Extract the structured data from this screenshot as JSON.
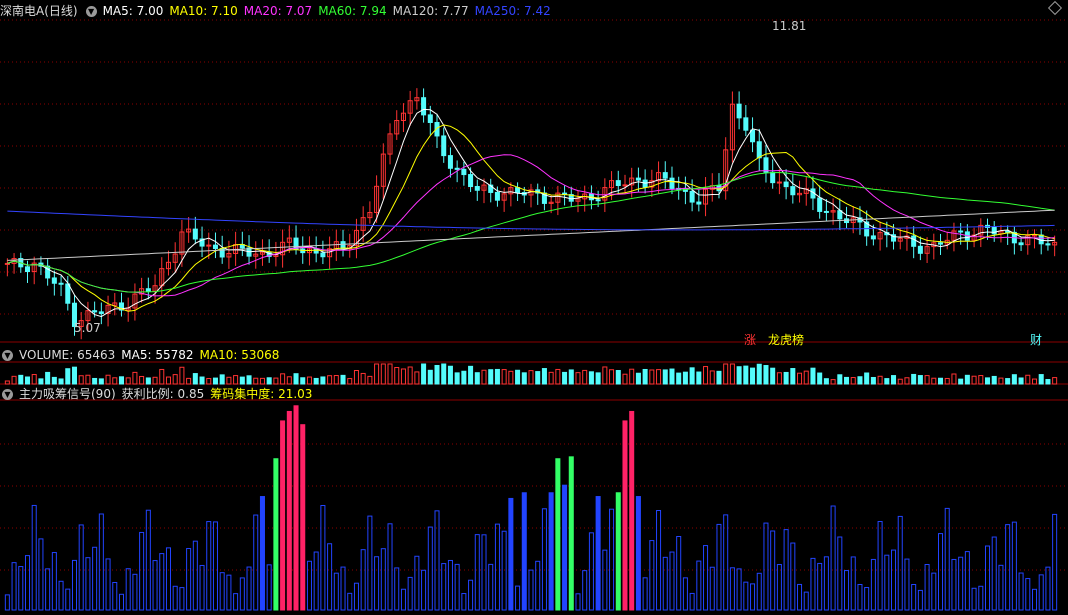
{
  "colors": {
    "up": "#ff3333",
    "down": "#54fcfc",
    "grid": "#8b0000",
    "ma5": "#ffffff",
    "ma10": "#ffff00",
    "ma20": "#ff33ff",
    "ma60": "#33ff33",
    "ma120": "#cccccc",
    "ma250": "#3344ff",
    "sig_blue": "#2244ff",
    "sig_red": "#ff2266",
    "sig_green": "#33ff66",
    "sig_yellow": "#ffee55"
  },
  "price_panel": {
    "title": "深南电A(日线)",
    "ma5_label": "MA5: 7.00",
    "ma10_label": "MA10: 7.10",
    "ma20_label": "MA20: 7.07",
    "ma60_label": "MA60: 7.94",
    "ma120_label": "MA120: 7.77",
    "ma250_label": "MA250: 7.42",
    "high_label": "11.81",
    "low_label": "5.07",
    "tag_zhang": "涨",
    "tag_longhu": "龙虎榜",
    "tag_cai": "财"
  },
  "volume_panel": {
    "title": "VOLUME: 65463",
    "ma5_label": "MA5: 55782",
    "ma10_label": "MA10: 53068"
  },
  "indicator_panel": {
    "title": "主力吸筹信号(90)",
    "profit_label": "获利比例: 0.85",
    "conc_label": "筹码集中度: 21.03"
  },
  "chart_data": {
    "type": "candlestick",
    "y_range": [
      4.7,
      12.2
    ],
    "days": 120,
    "extremes": {
      "high": 11.81,
      "low": 5.07
    },
    "ma_latest": {
      "MA5": 7.0,
      "MA10": 7.1,
      "MA20": 7.07,
      "MA60": 7.94,
      "MA120": 7.77,
      "MA250": 7.42
    },
    "volume_latest": {
      "VOLUME": 65463,
      "MA5": 55782,
      "MA10": 53068
    },
    "close_path": [
      [
        0,
        6.45
      ],
      [
        4,
        6.55
      ],
      [
        8,
        5.9
      ],
      [
        10,
        5.25
      ],
      [
        14,
        5.4
      ],
      [
        18,
        5.65
      ],
      [
        22,
        6.0
      ],
      [
        26,
        7.25
      ],
      [
        30,
        6.9
      ],
      [
        34,
        6.8
      ],
      [
        38,
        6.75
      ],
      [
        42,
        6.95
      ],
      [
        46,
        6.8
      ],
      [
        50,
        6.85
      ],
      [
        54,
        7.8
      ],
      [
        58,
        10.0
      ],
      [
        61,
        10.4
      ],
      [
        64,
        9.35
      ],
      [
        67,
        8.7
      ],
      [
        70,
        8.2
      ],
      [
        74,
        8.2
      ],
      [
        80,
        8.1
      ],
      [
        85,
        8.0
      ],
      [
        90,
        8.3
      ],
      [
        94,
        8.5
      ],
      [
        98,
        8.45
      ],
      [
        103,
        8.0
      ],
      [
        106,
        8.3
      ],
      [
        108,
        10.2
      ],
      [
        110,
        9.75
      ],
      [
        112,
        8.8
      ],
      [
        116,
        8.3
      ],
      [
        120,
        8.0
      ],
      [
        124,
        7.6
      ],
      [
        128,
        7.3
      ],
      [
        133,
        7.05
      ],
      [
        138,
        6.9
      ],
      [
        142,
        7.25
      ],
      [
        146,
        7.3
      ],
      [
        150,
        7.15
      ],
      [
        156,
        6.95
      ]
    ],
    "signal_bars": [
      {
        "day": 38,
        "value": 0.6,
        "color": "blue"
      },
      {
        "day": 40,
        "value": 0.8,
        "color": "green"
      },
      {
        "day": 41,
        "value": 1.0,
        "color": "red"
      },
      {
        "day": 42,
        "value": 1.05,
        "color": "red"
      },
      {
        "day": 43,
        "value": 1.08,
        "color": "red"
      },
      {
        "day": 44,
        "value": 0.98,
        "color": "red"
      },
      {
        "day": 75,
        "value": 0.59,
        "color": "blue"
      },
      {
        "day": 77,
        "value": 0.62,
        "color": "blue"
      },
      {
        "day": 81,
        "value": 0.62,
        "color": "blue"
      },
      {
        "day": 82,
        "value": 0.8,
        "color": "green"
      },
      {
        "day": 83,
        "value": 0.66,
        "color": "blue"
      },
      {
        "day": 84,
        "value": 0.81,
        "color": "green"
      },
      {
        "day": 88,
        "value": 0.6,
        "color": "blue"
      },
      {
        "day": 91,
        "value": 0.62,
        "color": "green"
      },
      {
        "day": 92,
        "value": 1.0,
        "color": "red"
      },
      {
        "day": 93,
        "value": 1.05,
        "color": "red"
      },
      {
        "day": 94,
        "value": 0.6,
        "color": "blue"
      }
    ]
  }
}
